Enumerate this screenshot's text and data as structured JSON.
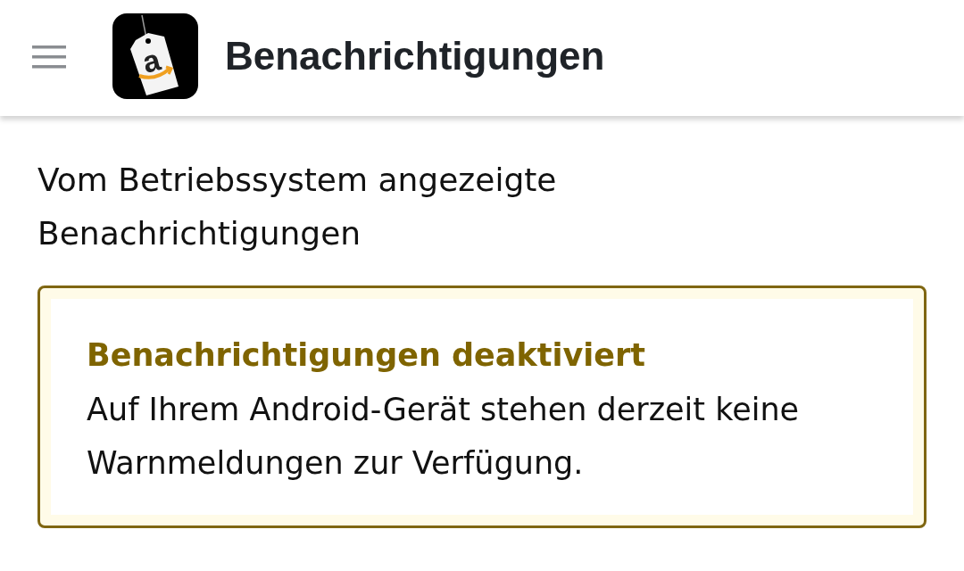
{
  "header": {
    "logo_letter": "a",
    "title": "Benachrichtigungen"
  },
  "section_title": "Vom Betriebssystem angezeigte Benachrichtigungen",
  "alert": {
    "kind": "warning",
    "title": "Benachrichtigungen deaktiviert",
    "message": "Auf Ihrem Android-Gerät stehen derzeit keine Warnmeldungen zur Verfügung."
  }
}
